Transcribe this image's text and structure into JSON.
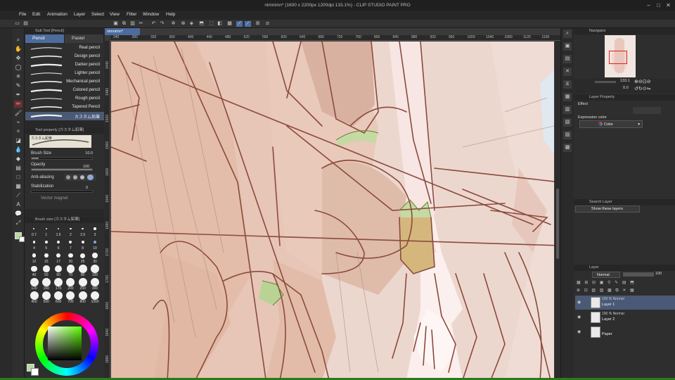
{
  "window": {
    "title": "nimnimn* (1600 x 2200px 1200dpi 133.1%) - CLIP STUDIO PAINT PRO",
    "controls": [
      "–",
      "□",
      "✕"
    ]
  },
  "menu": [
    "File",
    "Edit",
    "Animation",
    "Layer",
    "Select",
    "View",
    "Filter",
    "Window",
    "Help"
  ],
  "subtool": {
    "header": "Sub Tool [Pencil]",
    "tabs": [
      "Pencil",
      "Pastel"
    ],
    "brushes": [
      "Real pencil",
      "Design pencil",
      "Darker pencil",
      "Lighter pencil",
      "Mechanical pencil",
      "Colored pencil",
      "Rough pencil",
      "Tapered Pencil",
      "カスタム鉛筆"
    ],
    "selected_index": 8
  },
  "toolprop": {
    "header": "Tool property [カスタム鉛筆]",
    "preview_name": "カスタム鉛筆",
    "brush_size_label": "Brush Size",
    "brush_size_value": "10.0",
    "opacity_label": "Opacity",
    "opacity_value": "100",
    "antialias_label": "Anti-aliasing",
    "stabilization_label": "Stabilization",
    "stabilization_value": "0",
    "vector_magnet_label": "Vector magnet"
  },
  "brushsize": {
    "header": "Brush size [カスタム鉛筆]",
    "sizes": [
      "0.7",
      "1",
      "1.5",
      "2",
      "2.5",
      "3",
      "4",
      "5",
      "6",
      "7",
      "8",
      "10",
      "12",
      "15",
      "17",
      "20",
      "25",
      "30",
      "40",
      "50",
      "60",
      "70",
      "80",
      "100",
      "120",
      "150",
      "170",
      "200",
      "250",
      "300",
      "400",
      "500",
      "600",
      "700",
      "800",
      "1000"
    ],
    "selected": "10"
  },
  "color": {
    "main": "#b7dba0",
    "sub": "#ffffff"
  },
  "document": {
    "tab_label": "nimnimn*",
    "ruler_ticks": [
      "240",
      "280",
      "320",
      "360",
      "400",
      "440",
      "480",
      "520",
      "560",
      "600",
      "640",
      "680",
      "720",
      "760",
      "800",
      "840",
      "880",
      "920",
      "960",
      "1000",
      "1040",
      "1080",
      "1120",
      "1160"
    ],
    "vruler_ticks": [
      "1440",
      "1480",
      "1520",
      "1560",
      "1600",
      "1640",
      "1680",
      "1720",
      "1760",
      "1800",
      "1840",
      "1880"
    ]
  },
  "navigator": {
    "header": "Navigator",
    "zoom": "133.1",
    "rotation": "0.0"
  },
  "layer_property": {
    "header": "Layer Property",
    "effect_label": "Effect",
    "expression_label": "Expression color",
    "expression_value": "Color"
  },
  "search_layer": {
    "header": "Search Layer",
    "filter": "Show these layers"
  },
  "layers_panel": {
    "header": "Layer",
    "blend_mode": "Normal",
    "opacity": "100",
    "layers": [
      {
        "meta": "100 % Normal",
        "name": "Layer 1",
        "selected": true
      },
      {
        "meta": "100 % Normal",
        "name": "Layer 2",
        "selected": false
      },
      {
        "meta": "",
        "name": "Paper",
        "selected": false
      }
    ]
  }
}
